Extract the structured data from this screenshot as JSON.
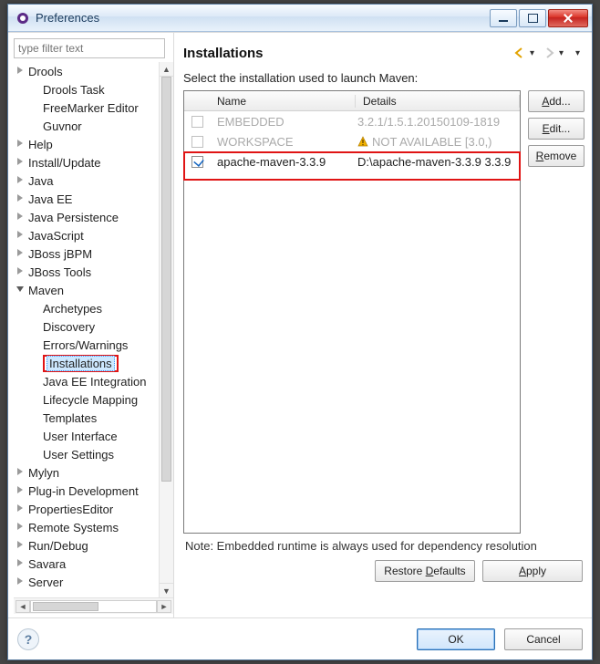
{
  "window": {
    "title": "Preferences"
  },
  "filter": {
    "placeholder": "type filter text"
  },
  "tree": [
    {
      "label": "Drools",
      "level": 0,
      "expander": "right"
    },
    {
      "label": "Drools Task",
      "level": 1,
      "expander": "none"
    },
    {
      "label": "FreeMarker Editor",
      "level": 1,
      "expander": "none"
    },
    {
      "label": "Guvnor",
      "level": 1,
      "expander": "none"
    },
    {
      "label": "Help",
      "level": 0,
      "expander": "right"
    },
    {
      "label": "Install/Update",
      "level": 0,
      "expander": "right"
    },
    {
      "label": "Java",
      "level": 0,
      "expander": "right"
    },
    {
      "label": "Java EE",
      "level": 0,
      "expander": "right"
    },
    {
      "label": "Java Persistence",
      "level": 0,
      "expander": "right"
    },
    {
      "label": "JavaScript",
      "level": 0,
      "expander": "right"
    },
    {
      "label": "JBoss jBPM",
      "level": 0,
      "expander": "right"
    },
    {
      "label": "JBoss Tools",
      "level": 0,
      "expander": "right"
    },
    {
      "label": "Maven",
      "level": 0,
      "expander": "down"
    },
    {
      "label": "Archetypes",
      "level": 1,
      "expander": "none"
    },
    {
      "label": "Discovery",
      "level": 1,
      "expander": "none"
    },
    {
      "label": "Errors/Warnings",
      "level": 1,
      "expander": "none"
    },
    {
      "label": "Installations",
      "level": 1,
      "expander": "none",
      "selected": true,
      "boxed": true
    },
    {
      "label": "Java EE Integration",
      "level": 1,
      "expander": "none"
    },
    {
      "label": "Lifecycle Mapping",
      "level": 1,
      "expander": "none"
    },
    {
      "label": "Templates",
      "level": 1,
      "expander": "none"
    },
    {
      "label": "User Interface",
      "level": 1,
      "expander": "none"
    },
    {
      "label": "User Settings",
      "level": 1,
      "expander": "none"
    },
    {
      "label": "Mylyn",
      "level": 0,
      "expander": "right"
    },
    {
      "label": "Plug-in Development",
      "level": 0,
      "expander": "right"
    },
    {
      "label": "PropertiesEditor",
      "level": 0,
      "expander": "right"
    },
    {
      "label": "Remote Systems",
      "level": 0,
      "expander": "right"
    },
    {
      "label": "Run/Debug",
      "level": 0,
      "expander": "right"
    },
    {
      "label": "Savara",
      "level": 0,
      "expander": "right"
    },
    {
      "label": "Server",
      "level": 0,
      "expander": "right"
    }
  ],
  "page": {
    "title": "Installations",
    "desc": "Select the installation used to launch Maven:",
    "note": "Note: Embedded runtime is always used for dependency resolution",
    "columns": {
      "name": "Name",
      "details": "Details"
    },
    "rows": [
      {
        "name": "EMBEDDED",
        "details": "3.2.1/1.5.1.20150109-1819",
        "checked": false,
        "dim": true
      },
      {
        "name": "WORKSPACE",
        "details": "NOT AVAILABLE [3.0,)",
        "checked": false,
        "dim": true,
        "warn": true
      },
      {
        "name": "apache-maven-3.3.9",
        "details": "D:\\apache-maven-3.3.9 3.3.9",
        "checked": true,
        "dim": false,
        "highlight": true
      }
    ],
    "side_buttons": {
      "add": "Add...",
      "edit": "Edit...",
      "remove": "Remove"
    },
    "lower_buttons": {
      "restore": "Restore Defaults",
      "apply": "Apply"
    }
  },
  "footer": {
    "ok": "OK",
    "cancel": "Cancel"
  },
  "mnemonics": {
    "add": "A",
    "edit": "E",
    "remove": "R",
    "restore_d": "D",
    "apply": "A"
  }
}
